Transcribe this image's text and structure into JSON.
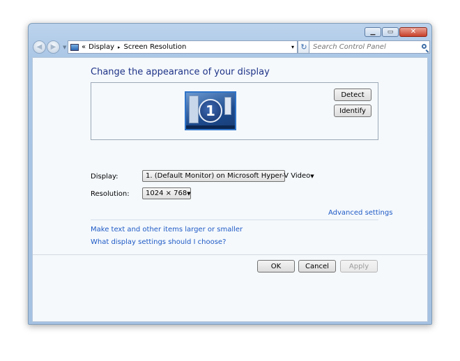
{
  "window": {
    "caption_buttons": {
      "minimize_icon": "minimize-icon",
      "maximize_icon": "maximize-icon",
      "close_icon": "close-icon"
    }
  },
  "addressbar": {
    "breadcrumb_prefix": "«",
    "segments": [
      "Display",
      "Screen Resolution"
    ],
    "separator": "▸",
    "dropdown": "▾",
    "refresh": "↻"
  },
  "search": {
    "placeholder": "Search Control Panel"
  },
  "main": {
    "heading": "Change the appearance of your display",
    "monitor_number": "1",
    "detect_label": "Detect",
    "identify_label": "Identify",
    "display_label": "Display:",
    "display_value": "1. (Default Monitor) on Microsoft Hyper-V Video",
    "resolution_label": "Resolution:",
    "resolution_value": "1024 × 768",
    "advanced_link": "Advanced settings",
    "link_text_size": "Make text and other items larger or smaller",
    "link_help": "What display settings should I choose?",
    "ok_label": "OK",
    "cancel_label": "Cancel",
    "apply_label": "Apply"
  },
  "colors": {
    "heading": "#1e3287",
    "link": "#1f5ac6",
    "content_bg": "#f5f9fc",
    "frame": "#aac6e6"
  }
}
